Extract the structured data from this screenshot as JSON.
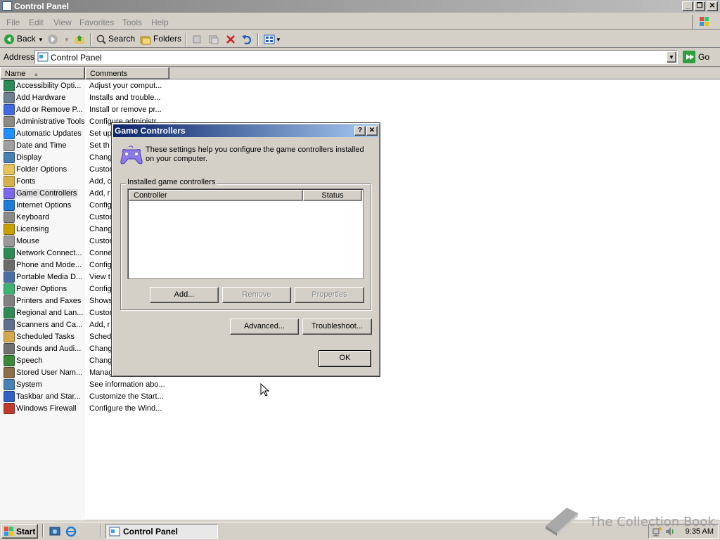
{
  "window": {
    "title": "Control Panel"
  },
  "menu": [
    "File",
    "Edit",
    "View",
    "Favorites",
    "Tools",
    "Help"
  ],
  "toolbar": {
    "back": "Back",
    "search": "Search",
    "folders": "Folders"
  },
  "address": {
    "label": "Address",
    "value": "Control Panel",
    "go": "Go"
  },
  "list": {
    "columns": {
      "name": "Name",
      "comments": "Comments"
    },
    "items": [
      {
        "name": "Accessibility Opti...",
        "comment": "Adjust your comput...",
        "icon": "accessibility-icon",
        "color": "#2e8b57"
      },
      {
        "name": "Add Hardware",
        "comment": "Installs and trouble...",
        "icon": "add-hardware-icon",
        "color": "#708090"
      },
      {
        "name": "Add or Remove P...",
        "comment": "Install or remove pr...",
        "icon": "add-remove-programs-icon",
        "color": "#4169e1"
      },
      {
        "name": "Administrative Tools",
        "comment": "Configure administr...",
        "icon": "administrative-tools-icon",
        "color": "#8b8b83"
      },
      {
        "name": "Automatic Updates",
        "comment": "Set up",
        "icon": "automatic-updates-icon",
        "color": "#1e90ff"
      },
      {
        "name": "Date and Time",
        "comment": "Set th",
        "icon": "date-time-icon",
        "color": "#a0a0a0"
      },
      {
        "name": "Display",
        "comment": "Chang",
        "icon": "display-icon",
        "color": "#4682b4"
      },
      {
        "name": "Folder Options",
        "comment": "Custon",
        "icon": "folder-options-icon",
        "color": "#e6c35c"
      },
      {
        "name": "Fonts",
        "comment": "Add, c",
        "icon": "fonts-icon",
        "color": "#d4b24c"
      },
      {
        "name": "Game Controllers",
        "comment": "Add, r",
        "icon": "game-controllers-icon",
        "color": "#7b68ee"
      },
      {
        "name": "Internet Options",
        "comment": "Config",
        "icon": "internet-options-icon",
        "color": "#1e7bd8"
      },
      {
        "name": "Keyboard",
        "comment": "Custon",
        "icon": "keyboard-icon",
        "color": "#8a8a8a"
      },
      {
        "name": "Licensing",
        "comment": "Chang",
        "icon": "licensing-icon",
        "color": "#c8a000"
      },
      {
        "name": "Mouse",
        "comment": "Custon",
        "icon": "mouse-icon",
        "color": "#9a9a9a"
      },
      {
        "name": "Network Connect...",
        "comment": "Conne",
        "icon": "network-connections-icon",
        "color": "#2e8b57"
      },
      {
        "name": "Phone and Mode...",
        "comment": "Config",
        "icon": "phone-modem-icon",
        "color": "#6b6b6b"
      },
      {
        "name": "Portable Media D...",
        "comment": "View t",
        "icon": "portable-media-icon",
        "color": "#4a6fa5"
      },
      {
        "name": "Power Options",
        "comment": "Config",
        "icon": "power-options-icon",
        "color": "#3cb371"
      },
      {
        "name": "Printers and Faxes",
        "comment": "Shows",
        "icon": "printers-faxes-icon",
        "color": "#808080"
      },
      {
        "name": "Regional and Lan...",
        "comment": "Custon",
        "icon": "regional-language-icon",
        "color": "#2e8b57"
      },
      {
        "name": "Scanners and Ca...",
        "comment": "Add, r",
        "icon": "scanners-cameras-icon",
        "color": "#5f6f8f"
      },
      {
        "name": "Scheduled Tasks",
        "comment": "Sched",
        "icon": "scheduled-tasks-icon",
        "color": "#d4a84c"
      },
      {
        "name": "Sounds and Audi...",
        "comment": "Chang",
        "icon": "sounds-audio-icon",
        "color": "#707070"
      },
      {
        "name": "Speech",
        "comment": "Chang",
        "icon": "speech-icon",
        "color": "#3a8a3a"
      },
      {
        "name": "Stored User Nam...",
        "comment": "Manag",
        "icon": "stored-user-names-icon",
        "color": "#8b6f47"
      },
      {
        "name": "System",
        "comment": "See information abo...",
        "icon": "system-icon",
        "color": "#4682b4"
      },
      {
        "name": "Taskbar and Star...",
        "comment": "Customize the Start...",
        "icon": "taskbar-start-icon",
        "color": "#3060c0"
      },
      {
        "name": "Windows Firewall",
        "comment": "Configure the Wind...",
        "icon": "windows-firewall-icon",
        "color": "#c0392b"
      }
    ]
  },
  "dialog": {
    "title": "Game Controllers",
    "description": "These settings help you configure the game controllers installed on your computer.",
    "group_label": "Installed game controllers",
    "columns": {
      "controller": "Controller",
      "status": "Status"
    },
    "buttons": {
      "add": "Add...",
      "remove": "Remove",
      "properties": "Properties",
      "advanced": "Advanced...",
      "troubleshoot": "Troubleshoot...",
      "ok": "OK"
    }
  },
  "taskbar": {
    "start": "Start",
    "task": "Control Panel",
    "clock": "9:35 AM"
  },
  "watermark": "The Collection Book"
}
